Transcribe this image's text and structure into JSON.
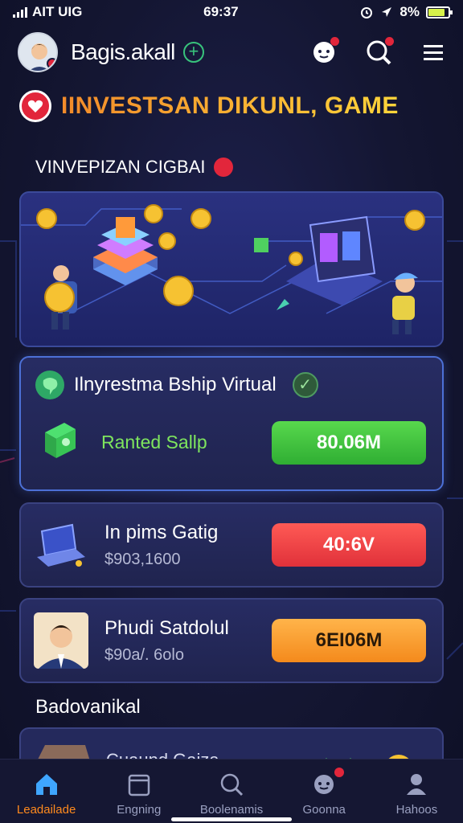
{
  "status_bar": {
    "carrier": "AIT UIG",
    "time": "69:37",
    "battery": "8%",
    "battery_level": 0.82,
    "battery_color": "#d7f24a"
  },
  "header": {
    "username": "Bagis.akall",
    "add_icon": "plus-circle-icon",
    "icons": [
      "chat-icon",
      "search-icon",
      "menu-icon"
    ]
  },
  "banner": {
    "title": "IINVESTSAN DIKUNL, GAME",
    "title_colors": [
      "#f28a2a",
      "#ffd53a"
    ]
  },
  "section": {
    "title": "VINVEPIZAN CIGBAI"
  },
  "feature_card": {
    "title": "Ilnyrestma Bship Virtual",
    "label": "Ranted Sallp",
    "amount": "80.06M",
    "accent": "#4c70d6"
  },
  "rows": [
    {
      "title": "In pims Gatig",
      "sub": "$903,1600",
      "amount": "40:6V",
      "color": "red"
    },
    {
      "title": "Phudi Satdolul",
      "sub": "$90a/. 6olo",
      "amount": "6EI06M",
      "color": "orange"
    }
  ],
  "subsection": {
    "title": "Badovanikal",
    "peek_text": "Cuaund Gaiza"
  },
  "bottom_nav": {
    "items": [
      {
        "label": "Leadailade",
        "icon": "home-icon",
        "active": true
      },
      {
        "label": "Engning",
        "icon": "wallet-icon",
        "active": false
      },
      {
        "label": "Boolenamis",
        "icon": "search-icon",
        "active": false
      },
      {
        "label": "Goonna",
        "icon": "chat-icon",
        "active": false
      },
      {
        "label": "Hahoos",
        "icon": "profile-icon",
        "active": false
      }
    ],
    "active_color": "#ff8a1d"
  }
}
